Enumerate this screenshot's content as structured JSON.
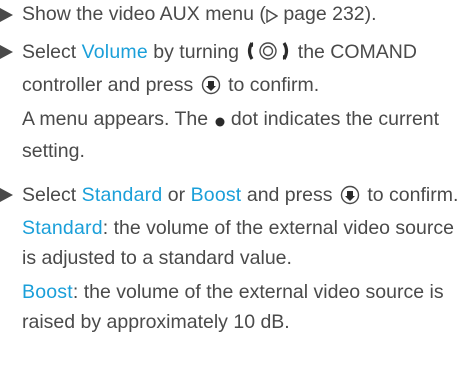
{
  "steps": [
    {
      "pre": "Show the video AUX menu (",
      "page_ref": "page 232",
      "post": ")."
    },
    {
      "pre": "Select ",
      "highlight": "Volume",
      "mid": " by turning ",
      "mid2": " the COMAND controller and press ",
      "post": " to confirm.",
      "result": "A menu appears. The ",
      "result_mid": " dot indicates the current setting."
    },
    {
      "pre": "Select ",
      "highlight1": "Standard",
      "or": " or ",
      "highlight2": "Boost",
      "mid": " and press ",
      "post": " to confirm.",
      "option1_label": "Standard",
      "option1_text": ": the volume of the external video source is adjusted to a standard value.",
      "option2_label": "Boost",
      "option2_text": ": the volume of the external video source is raised by approximately 10 dB."
    }
  ],
  "icons": {
    "step_marker": "triangle-right-icon",
    "page_ref": "outline-triangle-right-icon",
    "controller_turn": "controller-turn-icon",
    "controller_press": "controller-press-icon",
    "bullet_dot": "filled-dot-icon"
  },
  "colors": {
    "text": "#4a4a4a",
    "highlight": "#1a9fd9"
  }
}
